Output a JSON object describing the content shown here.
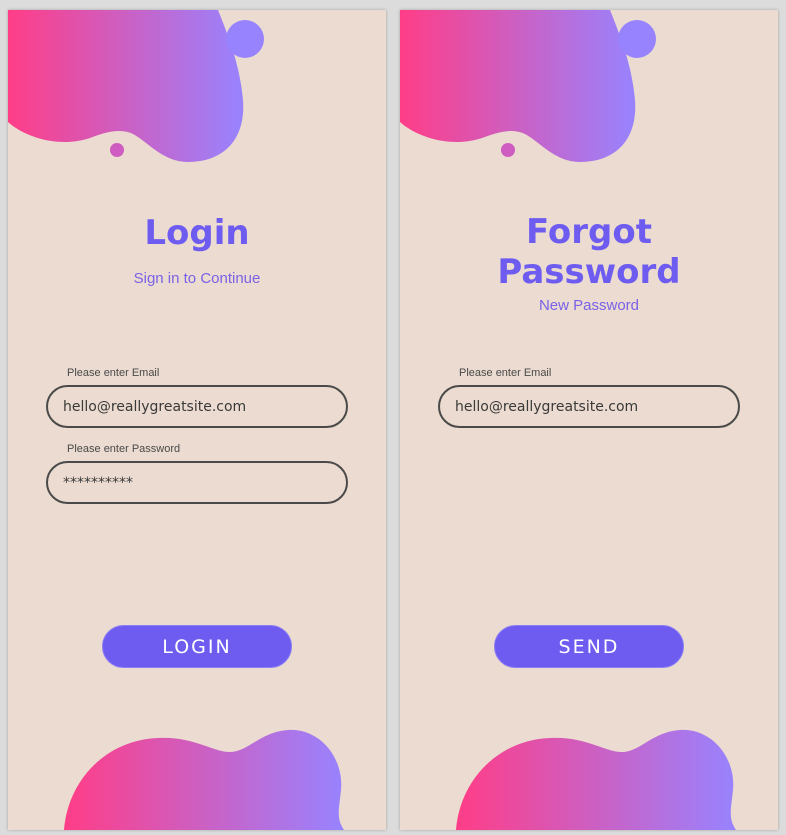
{
  "colors": {
    "background": "#ebdbd0",
    "accent": "#6e5cf0",
    "gradient_start": "#ff3d87",
    "gradient_end": "#9883ff",
    "field_border": "#4a4a4a"
  },
  "login": {
    "title": "Login",
    "subtitle": "Sign in to Continue",
    "email_label": "Please enter Email",
    "email_value": "hello@reallygreatsite.com",
    "password_label": "Please enter Password",
    "password_value": "**********",
    "button_label": "LOGIN"
  },
  "forgot": {
    "title_line1": "Forgot",
    "title_line2": "Password",
    "subtitle": "New Password",
    "email_label": "Please enter Email",
    "email_value": "hello@reallygreatsite.com",
    "button_label": "SEND"
  }
}
